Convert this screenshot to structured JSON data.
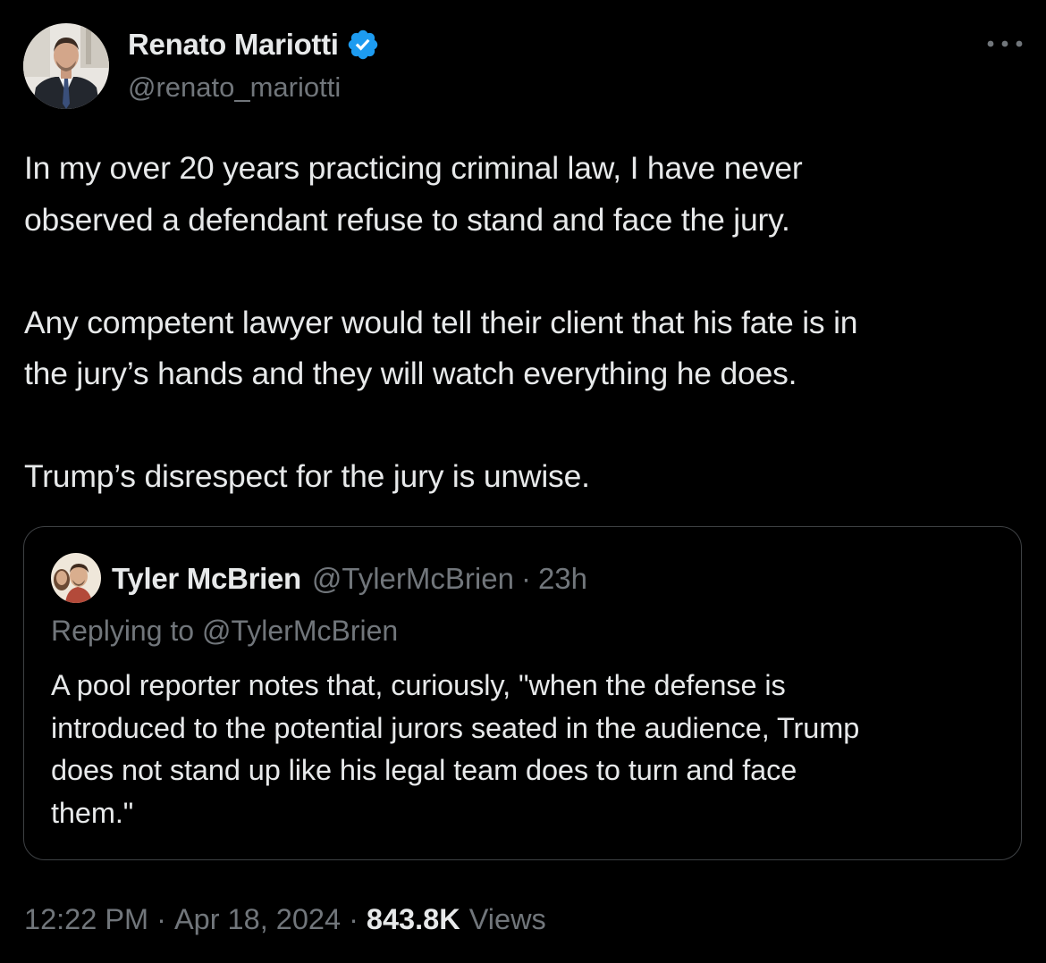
{
  "author": {
    "name": "Renato Mariotti",
    "handle": "@renato_mariotti",
    "verified": true,
    "avatar_icon": "person-avatar-icon",
    "verified_color": "#1d9bf0"
  },
  "more_menu_icon": "more-horizontal-icon",
  "tweet": {
    "paragraphs": [
      "In my over 20 years practicing criminal law, I have never\nobserved a defendant refuse to stand and face the jury.",
      "Any competent lawyer would tell their client that his fate is in\nthe jury’s hands and they will watch everything he does.",
      "Trump’s disrespect for the jury is unwise."
    ]
  },
  "quoted_tweet": {
    "author_name": "Tyler McBrien",
    "author_handle": "@TylerMcBrien",
    "separator": "·",
    "time": "23h",
    "replying_to": "Replying to @TylerMcBrien",
    "text": "A pool reporter notes that, curiously, \"when the defense is\nintroduced to the potential jurors seated in the audience, Trump\ndoes not stand up like his legal team does to turn and face\nthem.\"",
    "avatar_icon": "person-avatar-icon"
  },
  "meta": {
    "time": "12:22 PM",
    "date": "Apr 18, 2024",
    "separator": "·",
    "views_count": "843.8K",
    "views_label": "Views"
  },
  "colors": {
    "background": "#000000",
    "text_primary": "#e7e9ea",
    "text_secondary": "#71767b",
    "border": "#3e4144",
    "verified_blue": "#1d9bf0"
  }
}
